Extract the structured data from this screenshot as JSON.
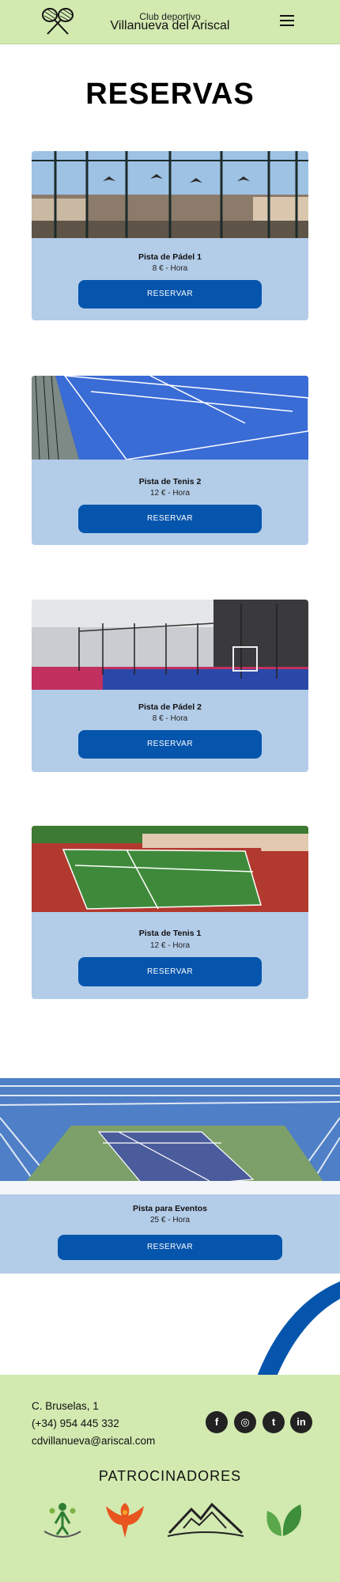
{
  "header": {
    "club_small": "Club deportivo",
    "club_name": "Villanueva del Ariscal",
    "logo_icon": "tennis-rackets-icon",
    "menu_icon": "hamburger-menu-icon"
  },
  "page_title": "RESERVAS",
  "courts": [
    {
      "name": "Pista de Pádel 1",
      "price": "8 € - Hora",
      "button": "RESERVAR"
    },
    {
      "name": "Pista de Tenis 2",
      "price": "12 € - Hora",
      "button": "RESERVAR"
    },
    {
      "name": "Pista de Pádel 2",
      "price": "8 € - Hora",
      "button": "RESERVAR"
    },
    {
      "name": "Pista de Tenis 1",
      "price": "12 € - Hora",
      "button": "RESERVAR"
    }
  ],
  "event": {
    "name": "Pista para Eventos",
    "price": "25 € - Hora",
    "button": "RESERVAR"
  },
  "footer": {
    "address": "C. Bruselas, 1",
    "phone": "(+34) 954 445 332",
    "email": "cdvillanueva@ariscal.com",
    "social": [
      {
        "label": "f",
        "icon": "facebook-icon"
      },
      {
        "label": "◎",
        "icon": "instagram-icon"
      },
      {
        "label": "t",
        "icon": "twitter-icon"
      },
      {
        "label": "in",
        "icon": "linkedin-icon"
      }
    ],
    "sponsors_title": "PATROCINADORES"
  },
  "colors": {
    "header_bg": "#d2e9b0",
    "card_bg": "#b3cce8",
    "button": "#0655ad",
    "swoosh": "#0655ad"
  }
}
